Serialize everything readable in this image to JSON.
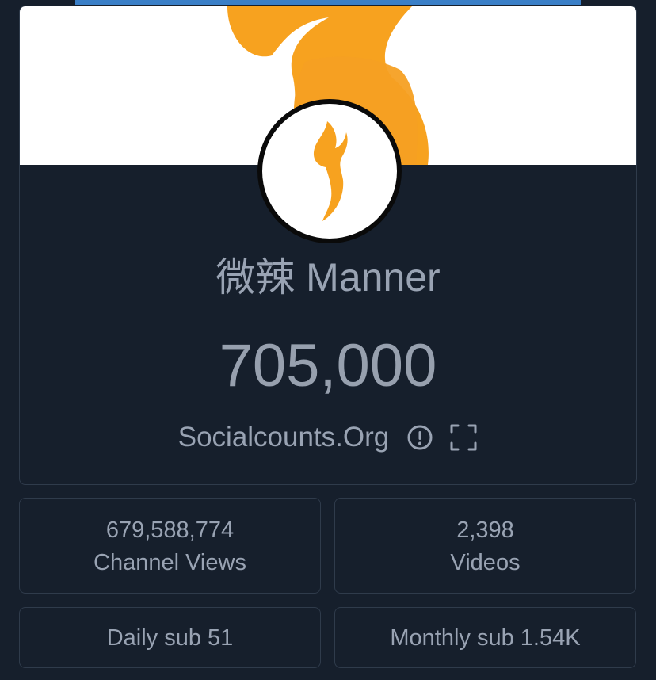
{
  "channel": {
    "name": "微辣 Manner",
    "subscriber_count": "705,000"
  },
  "source": {
    "label": "Socialcounts.Org",
    "info_icon": "info-circle-icon",
    "fullscreen_icon": "fullscreen-icon"
  },
  "stats": {
    "views_value": "679,588,774",
    "views_label": "Channel Views",
    "videos_value": "2,398",
    "videos_label": "Videos",
    "daily_sub": "Daily sub 51",
    "monthly_sub": "Monthly sub 1.54K"
  },
  "colors": {
    "background": "#161f2c",
    "text": "#99a3b3",
    "border": "#2f3b4b",
    "flame": "#f7a21f",
    "accent": "#3a7fc7"
  }
}
